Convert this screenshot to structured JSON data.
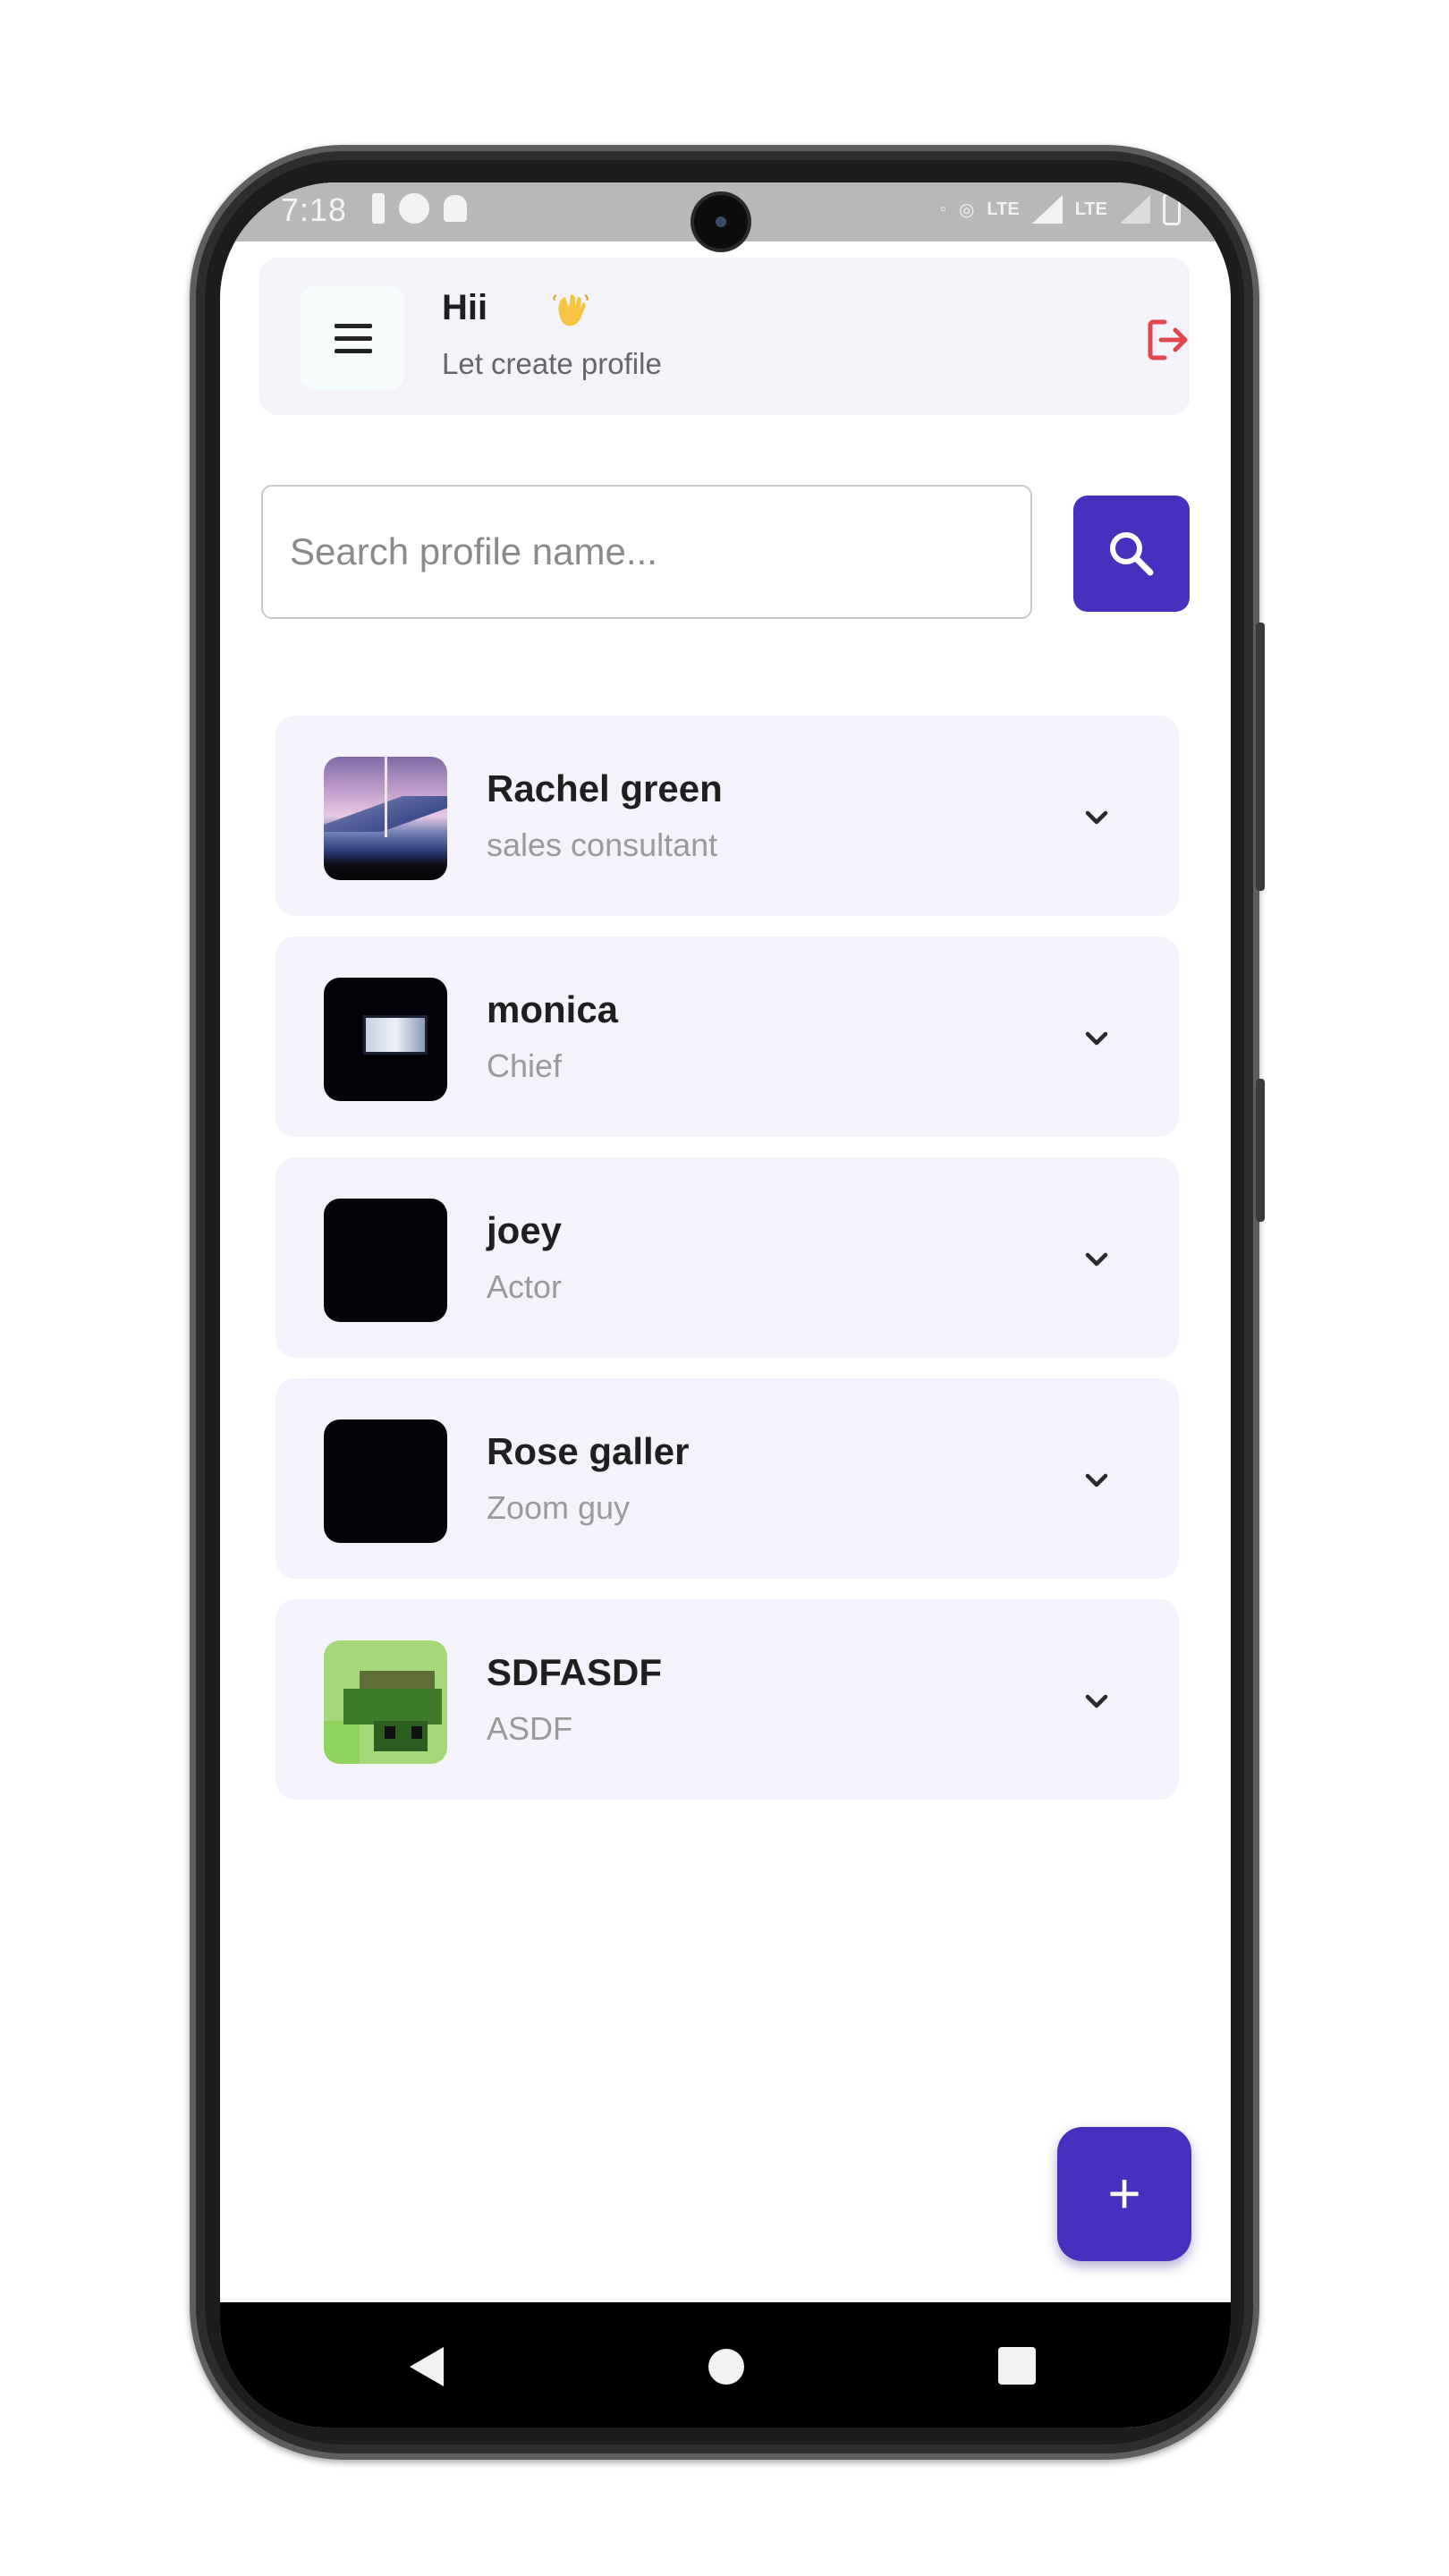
{
  "status_bar": {
    "time": "7:18",
    "left_icons": [
      "battery-saver-icon",
      "phone-icon",
      "android-icon"
    ],
    "right_icons": [
      "volte-icon",
      "hotspot-icon",
      "lte-icon",
      "signal-icon",
      "lte-signal-icon",
      "signal-weak-icon",
      "battery-icon"
    ],
    "right_text": [
      "LTE",
      "LTE"
    ]
  },
  "header": {
    "title": "Hii",
    "title_emoji_icon": "waving-hand-icon",
    "subtitle": "Let create profile",
    "menu_icon": "hamburger-menu-icon",
    "logout_icon": "logout-icon"
  },
  "search": {
    "placeholder": "Search profile name...",
    "value": "",
    "button_icon": "search-icon"
  },
  "profiles": [
    {
      "name": "Rachel green",
      "role": "sales consultant",
      "avatar": "mountain-photo"
    },
    {
      "name": "monica",
      "role": "Chief",
      "avatar": "dark-screen-photo"
    },
    {
      "name": "joey",
      "role": "Actor",
      "avatar": "black-photo"
    },
    {
      "name": "Rose galler",
      "role": "Zoom guy",
      "avatar": "black-photo"
    },
    {
      "name": "SDFASDF",
      "role": "ASDF",
      "avatar": "pixel-art-photo"
    }
  ],
  "fab": {
    "label": "+"
  },
  "colors": {
    "accent": "#4730be",
    "card_bg": "#f4f3fb",
    "logout": "#e0474c",
    "subtitle_gray": "#9a9a9a"
  },
  "nav_bar": {
    "buttons": [
      "back-icon",
      "home-icon",
      "recents-icon"
    ]
  }
}
